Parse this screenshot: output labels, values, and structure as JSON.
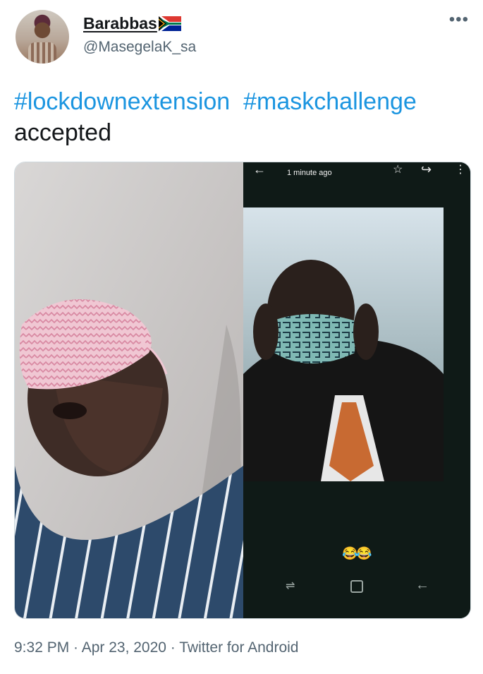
{
  "author": {
    "display_name": "Barabbas",
    "handle": "@MasegelaK_sa",
    "name_emoji_icon": "south-africa-flag-icon"
  },
  "more_icon": "more-horizontal-icon",
  "tweet": {
    "hashtag_1": "#lockdownextension",
    "hashtag_2": "#maskchallenge",
    "body_text": "accepted"
  },
  "media": {
    "right_photo": {
      "status_time": "1 minute ago",
      "reaction_emojis": "😂😂",
      "icons": [
        "back-arrow-icon",
        "star-icon",
        "share-icon",
        "menu-icon",
        "recent-apps-icon",
        "home-icon",
        "nav-back-icon"
      ]
    }
  },
  "footer": {
    "timestamp": "9:32 PM · Apr 23, 2020 · Twitter for Android"
  },
  "colors": {
    "hashtag": "#1b95e0",
    "secondary_text": "#536471",
    "primary_text": "#14171a"
  }
}
